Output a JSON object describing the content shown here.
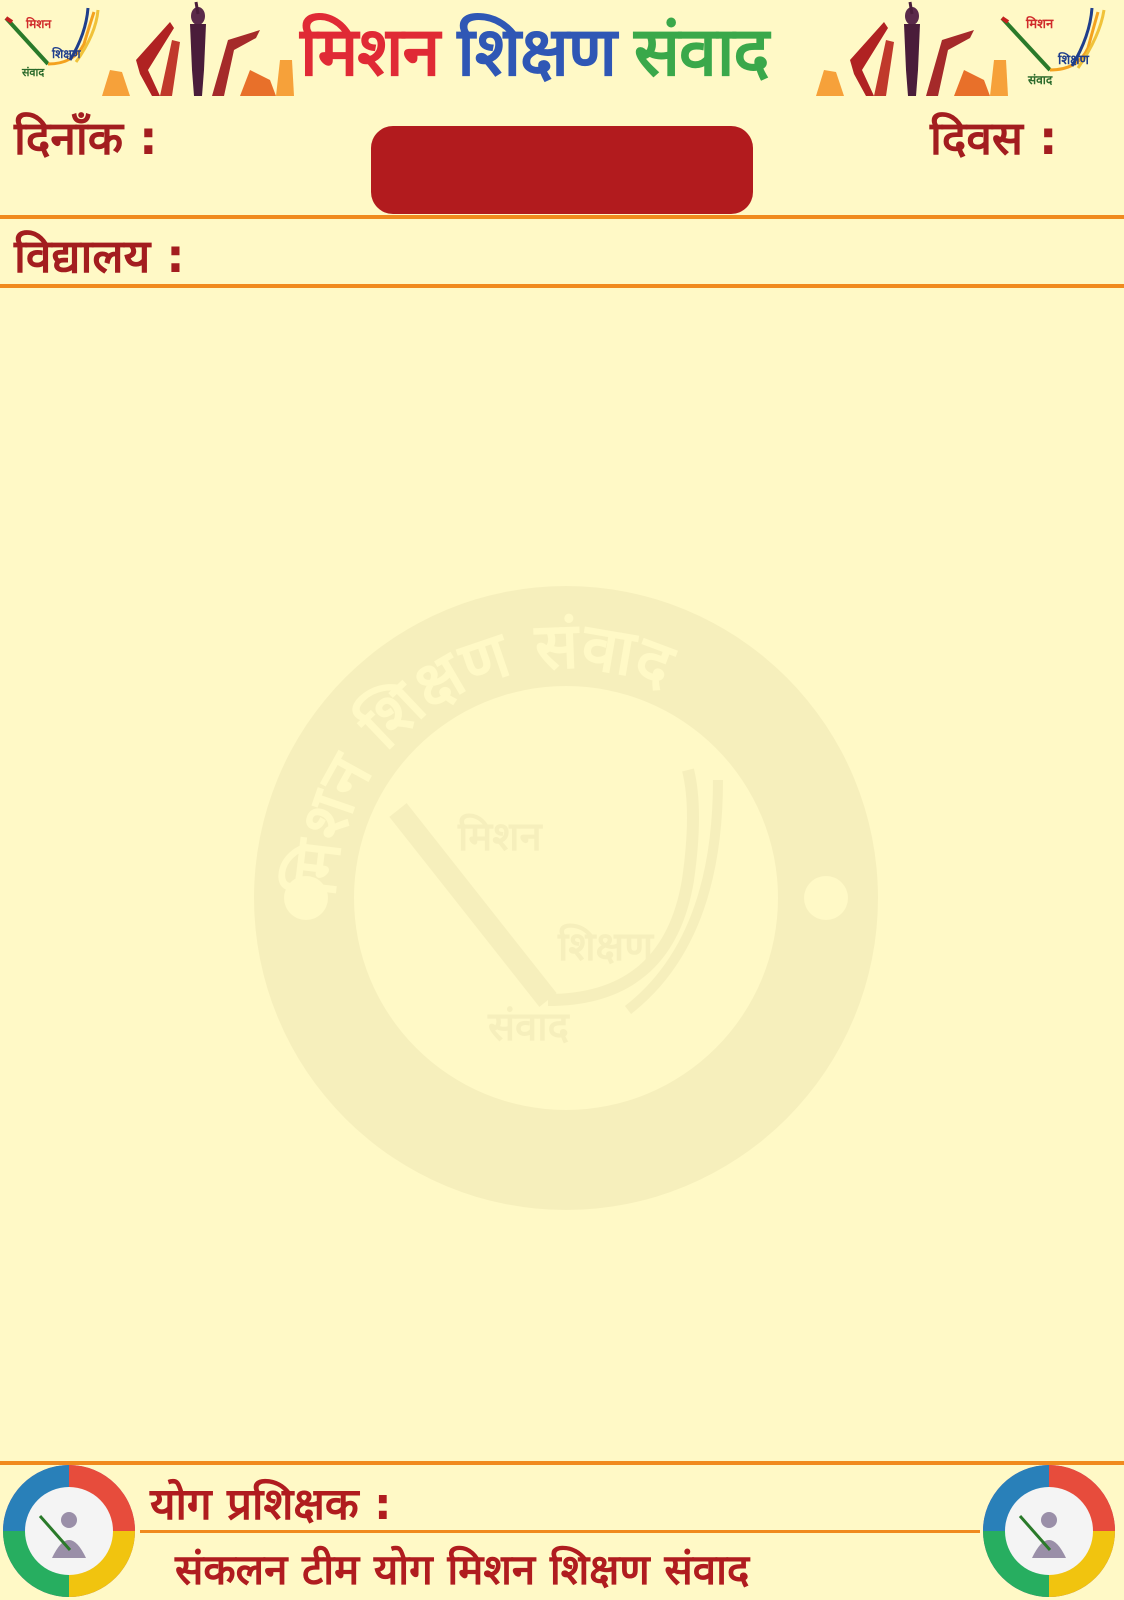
{
  "header": {
    "title_words": [
      {
        "text": "मिशन",
        "color": "#e02a35"
      },
      {
        "text": "शिक्षण",
        "color": "#2f57b5"
      },
      {
        "text": "संवाद",
        "color": "#3aa84a"
      }
    ],
    "logo_text": {
      "line1": "मिशन",
      "line2": "शिक्षण",
      "line3": "संवाद"
    },
    "date_label": "दिनाँक :",
    "day_label": "दिवस :",
    "school_label": "विद्यालय :"
  },
  "watermark": {
    "ring_text": "मिशन शिक्षण संवाद",
    "line1": "मिशन",
    "line2": "शिक्षण",
    "line3": "संवाद"
  },
  "footer": {
    "trainer_label": "योग प्रशिक्षक :",
    "credit": "संकलन टीम योग मिशन शिक्षण संवाद"
  },
  "colors": {
    "background": "#fff9c6",
    "accent_orange": "#f08a1e",
    "label_red": "#a31d1f",
    "box_red": "#b21b1e"
  }
}
